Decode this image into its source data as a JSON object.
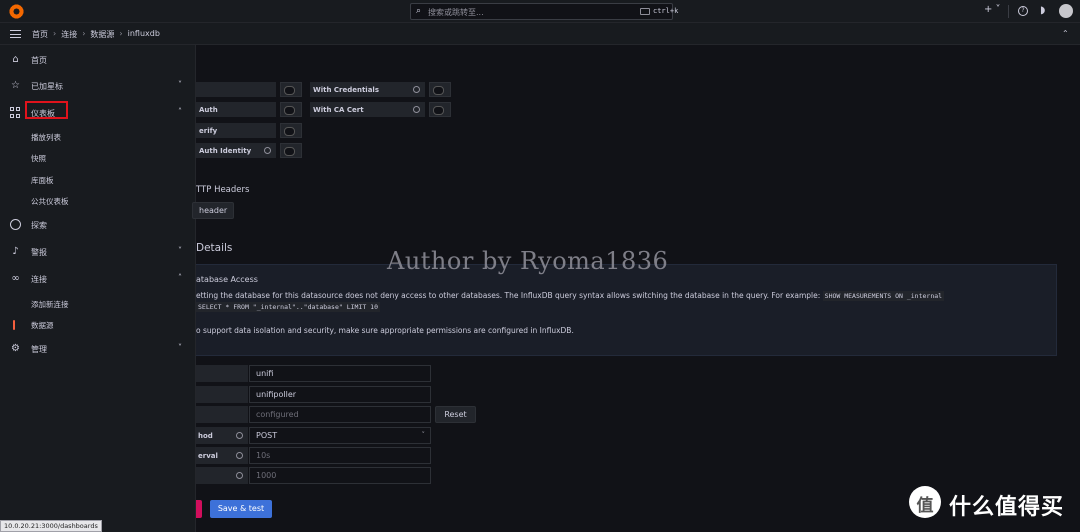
{
  "topbar": {
    "search_placeholder": "搜索或跳转至...",
    "search_shortcut": "ctrl+k",
    "plus": "+ ˅"
  },
  "breadcrumb": [
    "首页",
    "连接",
    "数据源",
    "influxdb"
  ],
  "sidebar": {
    "items": [
      {
        "label": "首页",
        "icon": "home-icon"
      },
      {
        "label": "已加星标",
        "icon": "star-icon"
      },
      {
        "label": "仪表板",
        "icon": "apps-icon"
      },
      {
        "label": "播放列表"
      },
      {
        "label": "快照"
      },
      {
        "label": "库面板"
      },
      {
        "label": "公共仪表板"
      },
      {
        "label": "探索",
        "icon": "compass-icon"
      },
      {
        "label": "警报",
        "icon": "bell-icon"
      },
      {
        "label": "连接",
        "icon": "link-icon"
      },
      {
        "label": "添加新连接"
      },
      {
        "label": "数据源"
      },
      {
        "label": "管理",
        "icon": "cog-icon"
      }
    ]
  },
  "auth": {
    "rows_left": [
      "",
      "Auth",
      "erify",
      "Auth Identity"
    ],
    "with_credentials": "With Credentials",
    "with_ca_cert": "With CA Cert"
  },
  "headers": {
    "title": "TTP Headers",
    "add_button": "header"
  },
  "details": {
    "title": "Details",
    "alert_title": "atabase Access",
    "alert_line1": "etting the database for this datasource does not deny access to other databases. The InfluxDB query syntax allows switching the database in the query. For example:",
    "alert_code1": "SHOW MEASUREMENTS ON _internal",
    "alert_code2": "SELECT * FROM \"_internal\"..\"database\" LIMIT 10",
    "alert_line3": "o support data isolation and security, make sure appropriate permissions are configured in InfluxDB."
  },
  "fields": {
    "database": "unifi",
    "user": "unifipoller",
    "password": "configured",
    "reset": "Reset",
    "method_label": "hod",
    "method": "POST",
    "interval_label": "erval",
    "interval": "10s",
    "max_series_placeholder": "1000"
  },
  "actions": {
    "save_test": "Save & test"
  },
  "watermark": "Author by Ryoma1836",
  "statusbar": "10.0.20.21:3000/dashboards",
  "brand": {
    "logo_char": "值",
    "text": "什么值得买"
  }
}
